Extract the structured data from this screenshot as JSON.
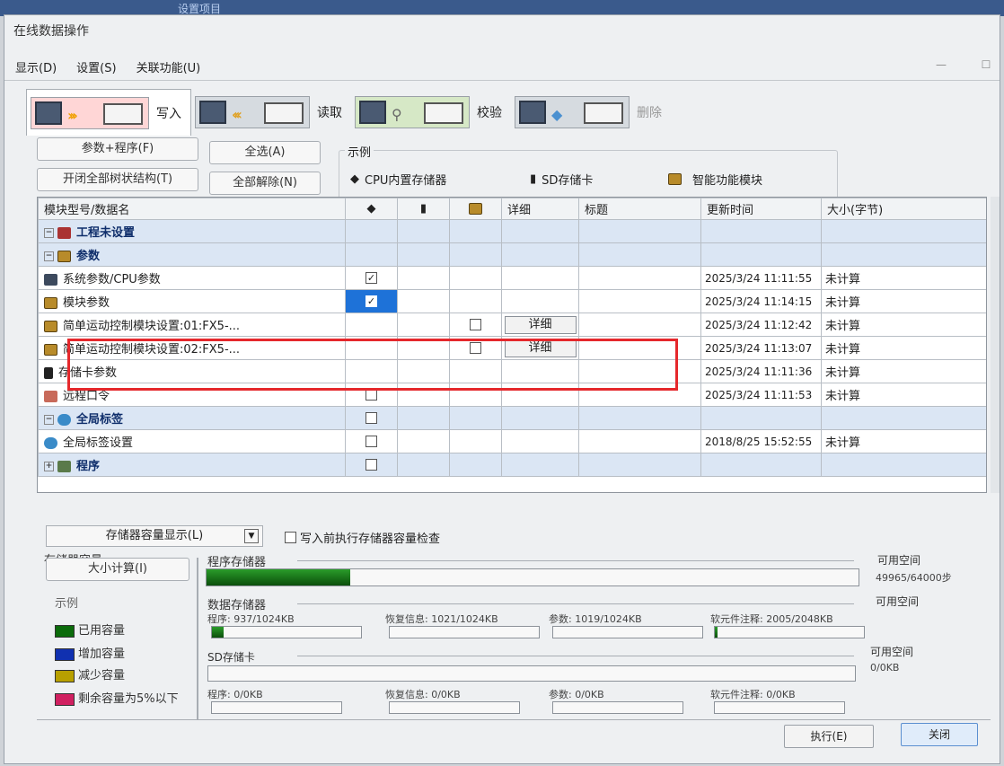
{
  "background_title": "设置项目",
  "window": {
    "title": "在线数据操作"
  },
  "menu": [
    {
      "label": "显示(D)"
    },
    {
      "label": "设置(S)"
    },
    {
      "label": "关联功能(U)"
    }
  ],
  "modes": [
    {
      "label": "写入",
      "icon": "write-icon"
    },
    {
      "label": "读取",
      "icon": "read-icon"
    },
    {
      "label": "校验",
      "icon": "verify-icon"
    },
    {
      "label": "删除",
      "icon": "delete-icon"
    }
  ],
  "buttons": {
    "param_prog": "参数+程序(F)",
    "select_all": "全选(A)",
    "expand_tree": "开闭全部树状结构(T)",
    "deselect_all": "全部解除(N)"
  },
  "legend_top": {
    "caption": "示例",
    "items": [
      "CPU内置存储器",
      "SD存储卡",
      "智能功能模块"
    ]
  },
  "table": {
    "headers": [
      "模块型号/数据名",
      "",
      "",
      "",
      "详细",
      "标题",
      "更新时间",
      "大小(字节)"
    ],
    "detail_label": "详细",
    "rows": [
      {
        "name": "工程未设置",
        "level": 0,
        "group": true,
        "toggle": "−",
        "icon": "proj"
      },
      {
        "name": "参数",
        "level": 1,
        "group": true,
        "toggle": "−",
        "icon": "mod"
      },
      {
        "name": "系统参数/CPU参数",
        "level": 2,
        "icon": "cpu",
        "cpu_check": "checked",
        "time": "2025/3/24 11:11:55",
        "size": "未计算"
      },
      {
        "name": "模块参数",
        "level": 2,
        "icon": "mod",
        "cpu_check": "checked",
        "cpu_selected": true,
        "time": "2025/3/24 11:14:15",
        "size": "未计算"
      },
      {
        "name": "简单运动控制模块设置:01:FX5-...",
        "level": 2,
        "icon": "mod",
        "intel_check": "unchecked",
        "detail": true,
        "time": "2025/3/24 11:12:42",
        "size": "未计算"
      },
      {
        "name": "简单运动控制模块设置:02:FX5-...",
        "level": 2,
        "icon": "mod",
        "intel_check": "unchecked",
        "detail": true,
        "time": "2025/3/24 11:13:07",
        "size": "未计算"
      },
      {
        "name": "存储卡参数",
        "level": 2,
        "icon": "card",
        "time": "2025/3/24 11:11:36",
        "size": "未计算"
      },
      {
        "name": "远程口令",
        "level": 2,
        "icon": "remote",
        "cpu_check": "unchecked",
        "time": "2025/3/24 11:11:53",
        "size": "未计算"
      },
      {
        "name": "全局标签",
        "level": 1,
        "group": true,
        "toggle": "−",
        "icon": "glob",
        "cpu_check": "unchecked"
      },
      {
        "name": "全局标签设置",
        "level": 2,
        "icon": "glob",
        "cpu_check": "unchecked",
        "time": "2018/8/25 15:52:55",
        "size": "未计算"
      },
      {
        "name": "程序",
        "level": 1,
        "group": true,
        "toggle": "+",
        "icon": "prog",
        "cpu_check": "unchecked"
      }
    ]
  },
  "capacity": {
    "dropdown": "存储器容量显示(L)",
    "check_label": "写入前执行存储器容量检查",
    "section_title": "存储器容量",
    "calc_button": "大小计算(I)",
    "legend_caption": "示例",
    "legend": [
      {
        "label": "已用容量",
        "color": "#0b6b0b"
      },
      {
        "label": "增加容量",
        "color": "#1030b0"
      },
      {
        "label": "减少容量",
        "color": "#b8a000"
      },
      {
        "label": "剩余容量为5%以下",
        "color": "#d02060"
      }
    ],
    "program_memory": {
      "label": "程序存储器",
      "free_label": "可用空间",
      "free_value": "49965/64000步",
      "fill": 0.22
    },
    "data_memory": {
      "label": "数据存储器",
      "free_label": "可用空间",
      "items": [
        {
          "label": "程序: 937/1024KB",
          "fill": 0.08
        },
        {
          "label": "恢复信息: 1021/1024KB",
          "fill": 0.0
        },
        {
          "label": "参数: 1019/1024KB",
          "fill": 0.0
        },
        {
          "label": "软元件注释: 2005/2048KB",
          "fill": 0.02
        }
      ]
    },
    "sd_card": {
      "label": "SD存储卡",
      "free_label": "可用空间",
      "free_value": "0/0KB",
      "items": [
        {
          "label": "程序: 0/0KB"
        },
        {
          "label": "恢复信息: 0/0KB"
        },
        {
          "label": "参数: 0/0KB"
        },
        {
          "label": "软元件注释: 0/0KB"
        }
      ]
    }
  },
  "footer": {
    "execute": "执行(E)",
    "close": "关闭"
  }
}
